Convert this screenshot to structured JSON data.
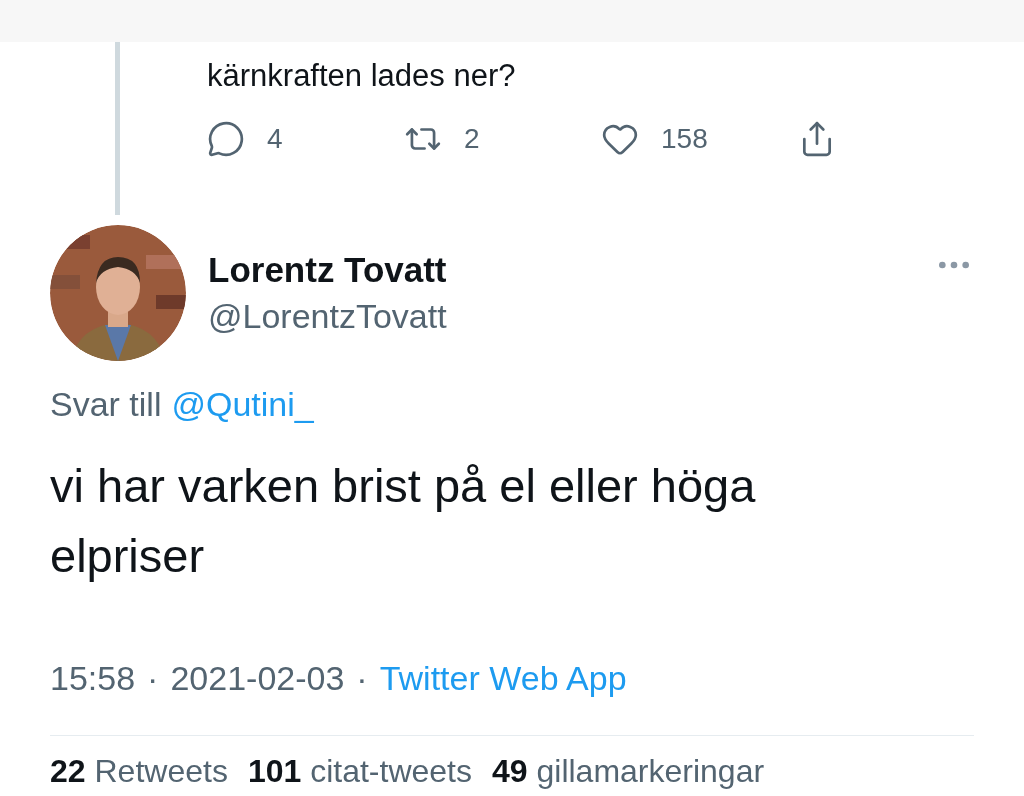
{
  "parent_tweet": {
    "text": "kärnkraften lades ner?",
    "actions": [
      {
        "kind": "reply",
        "count": "4"
      },
      {
        "kind": "retweet",
        "count": "2"
      },
      {
        "kind": "like",
        "count": "158"
      },
      {
        "kind": "share"
      }
    ]
  },
  "tweet": {
    "name": "Lorentz Tovatt",
    "handle": "@LorentzTovatt",
    "reply_label": "Svar till",
    "reply_to": "@Qutini_",
    "text": "vi har varken brist på el eller höga elpriser",
    "separator": "·",
    "time": "15:58",
    "date": "2021-02-03",
    "source": "Twitter Web App",
    "stats": [
      {
        "count": "22",
        "label": "Retweets"
      },
      {
        "count": "101",
        "label": "citat-tweets"
      },
      {
        "count": "49",
        "label": "gillamarkeringar"
      }
    ]
  }
}
